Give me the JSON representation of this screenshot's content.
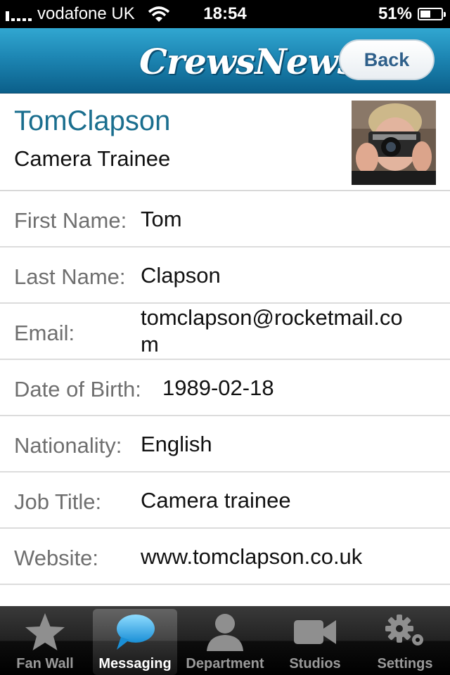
{
  "status_bar": {
    "carrier": "vodafone UK",
    "time": "18:54",
    "battery": "51%",
    "battery_level": 0.51
  },
  "nav": {
    "title": "CrewsNews",
    "back_label": "Back"
  },
  "profile": {
    "full_name": "TomClapson",
    "role": "Camera Trainee",
    "fields": [
      {
        "label": "First Name:",
        "value": "Tom"
      },
      {
        "label": "Last Name:",
        "value": "Clapson"
      },
      {
        "label": "Email:",
        "value": "tomclapson@rocketmail.co",
        "value_wrap": "m"
      },
      {
        "label": "Date of Birth:",
        "value": "1989-02-18"
      },
      {
        "label": "Nationality:",
        "value": "English"
      },
      {
        "label": "Job Title:",
        "value": "Camera trainee"
      },
      {
        "label": "Website:",
        "value": "www.tomclapson.co.uk"
      }
    ]
  },
  "tabs": [
    {
      "label": "Fan Wall",
      "icon": "star-icon",
      "active": false
    },
    {
      "label": "Messaging",
      "icon": "speech-bubble-icon",
      "active": true
    },
    {
      "label": "Department",
      "icon": "person-icon",
      "active": false
    },
    {
      "label": "Studios",
      "icon": "video-camera-icon",
      "active": false
    },
    {
      "label": "Settings",
      "icon": "gear-icon",
      "active": false
    }
  ]
}
